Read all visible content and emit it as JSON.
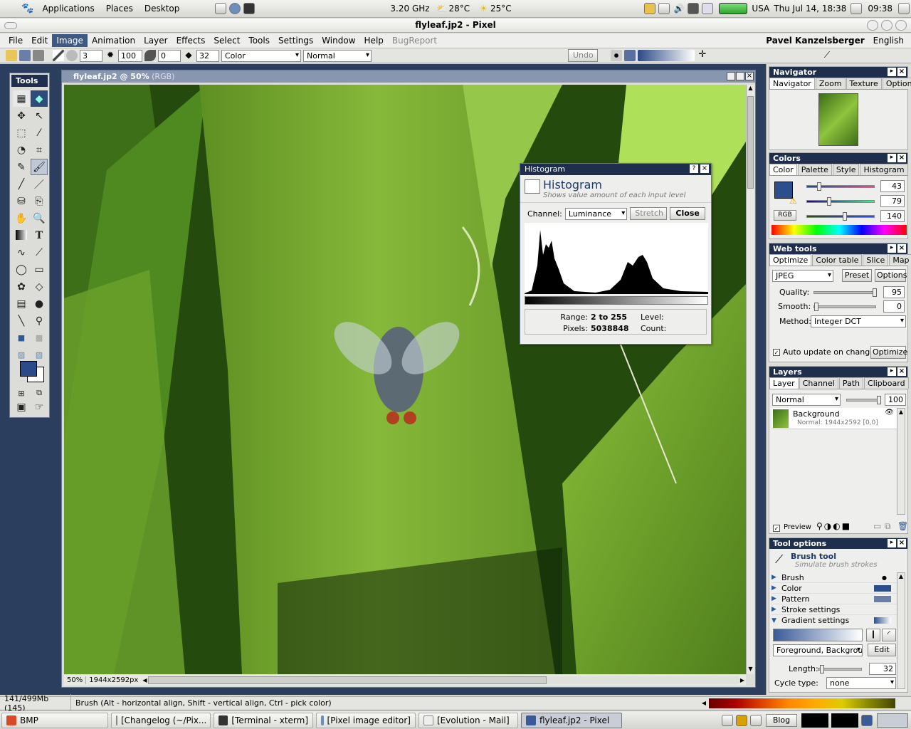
{
  "panel": {
    "menus": [
      "Applications",
      "Places",
      "Desktop"
    ],
    "cpu": "3.20 GHz",
    "weather1": "28°C",
    "weather2": "25°C",
    "locale": "USA",
    "datetime": "Thu Jul 14, 18:38",
    "clock": "09:38"
  },
  "window": {
    "title": "flyleaf.jp2 - Pixel"
  },
  "menubar": {
    "items": [
      "File",
      "Edit",
      "Image",
      "Animation",
      "Layer",
      "Effects",
      "Select",
      "Tools",
      "Settings",
      "Window",
      "Help",
      "BugReport"
    ],
    "active": "Image",
    "user": "Pavel Kanzelsberger",
    "language": "English"
  },
  "toolbar": {
    "size": "3",
    "opacity": "100",
    "angle": "0",
    "spacing": "32",
    "mode": "Color",
    "blend": "Normal",
    "undo": "Undo"
  },
  "tools": {
    "title": "Tools",
    "fg_color": "#2b4a8a"
  },
  "image_window": {
    "title": "flyleaf.jp2 @ 50%",
    "mode": "(RGB)",
    "zoom": "50%",
    "size": "1944x2592px"
  },
  "histogram": {
    "caption": "Histogram",
    "title": "Histogram",
    "subtitle": "Shows value amount of each input level",
    "channel_label": "Channel:",
    "channel": "Luminance",
    "stretch": "Stretch",
    "close": "Close",
    "range_label": "Range:",
    "range": "2 to 255",
    "pixels_label": "Pixels:",
    "pixels": "5038848",
    "level_label": "Level:",
    "count_label": "Count:"
  },
  "navigator": {
    "title": "Navigator",
    "tabs": [
      "Navigator",
      "Zoom",
      "Texture",
      "Options"
    ]
  },
  "colors": {
    "title": "Colors",
    "tabs": [
      "Color",
      "Palette",
      "Style",
      "Histogram"
    ],
    "values": [
      "43",
      "79",
      "140"
    ],
    "model": "RGB",
    "swatch": "#2b4f8c"
  },
  "webtools": {
    "title": "Web tools",
    "tabs": [
      "Optimize",
      "Color table",
      "Slice",
      "Map"
    ],
    "format": "JPEG",
    "preset": "Preset",
    "options": "Options",
    "quality_label": "Quality:",
    "quality": "95",
    "smooth_label": "Smooth:",
    "smooth": "0",
    "method_label": "Method:",
    "method": "Integer DCT",
    "auto_update": "Auto update on change",
    "optimize": "Optimize"
  },
  "layers": {
    "title": "Layers",
    "tabs": [
      "Layer",
      "Channel",
      "Path",
      "Clipboard"
    ],
    "blend": "Normal",
    "opacity": "100",
    "layer_name": "Background",
    "layer_info": "Normal: 1944x2592 [0,0]",
    "preview": "Preview"
  },
  "tool_options": {
    "title": "Tool options",
    "tool_name": "Brush tool",
    "tool_desc": "Simulate brush strokes",
    "sections": [
      "Brush",
      "Color",
      "Pattern",
      "Stroke settings",
      "Gradient settings"
    ],
    "gradient": "Foreground, Backgrou",
    "edit": "Edit",
    "length_label": "Length:",
    "length": "32",
    "cycle_label": "Cycle type:",
    "cycle": "none"
  },
  "status": {
    "memory": "141/499Mb (145)",
    "hint": "Brush (Alt - horizontal align, Shift - vertical align, Ctrl - pick color)"
  },
  "taskbar": {
    "tasks": [
      "BMP",
      "[Changelog (~/Pix...",
      "[Terminal - xterm]",
      "[Pixel image editor]",
      "[Evolution - Mail]",
      "flyleaf.jp2 - Pixel"
    ],
    "blog": "Blog"
  }
}
